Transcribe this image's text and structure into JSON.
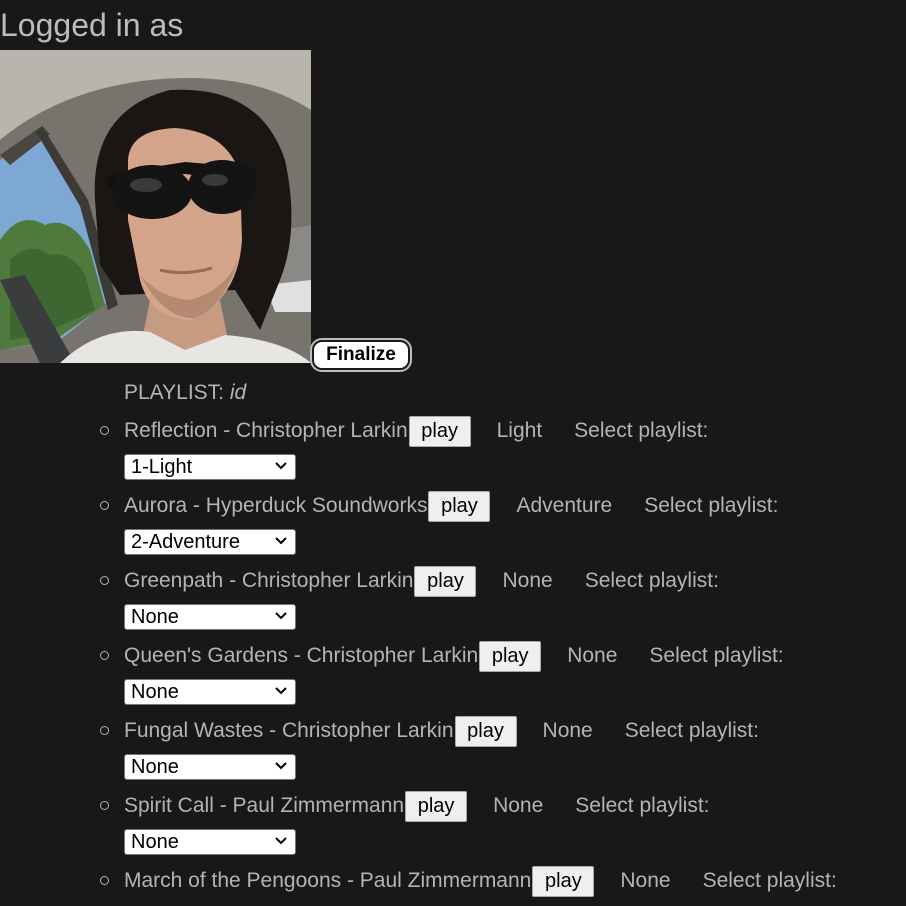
{
  "header": {
    "logged_in_label": "Logged in as"
  },
  "finalize_label": "Finalize",
  "playlist": {
    "label": "PLAYLIST:",
    "id": "id"
  },
  "select_playlist_label": "Select playlist:",
  "play_label": "play",
  "songs": [
    {
      "title": "Reflection - Christopher Larkin",
      "category": "Light",
      "selected": "1-Light"
    },
    {
      "title": "Aurora - Hyperduck Soundworks",
      "category": "Adventure",
      "selected": "2-Adventure"
    },
    {
      "title": "Greenpath - Christopher Larkin",
      "category": "None",
      "selected": "None"
    },
    {
      "title": "Queen's Gardens - Christopher Larkin",
      "category": "None",
      "selected": "None"
    },
    {
      "title": "Fungal Wastes - Christopher Larkin",
      "category": "None",
      "selected": "None"
    },
    {
      "title": "Spirit Call - Paul Zimmermann",
      "category": "None",
      "selected": "None"
    },
    {
      "title": "March of the Pengoons - Paul Zimmermann",
      "category": "None",
      "selected": ""
    }
  ],
  "colors": {
    "background": "#181818",
    "text": "#b4b4b4"
  }
}
